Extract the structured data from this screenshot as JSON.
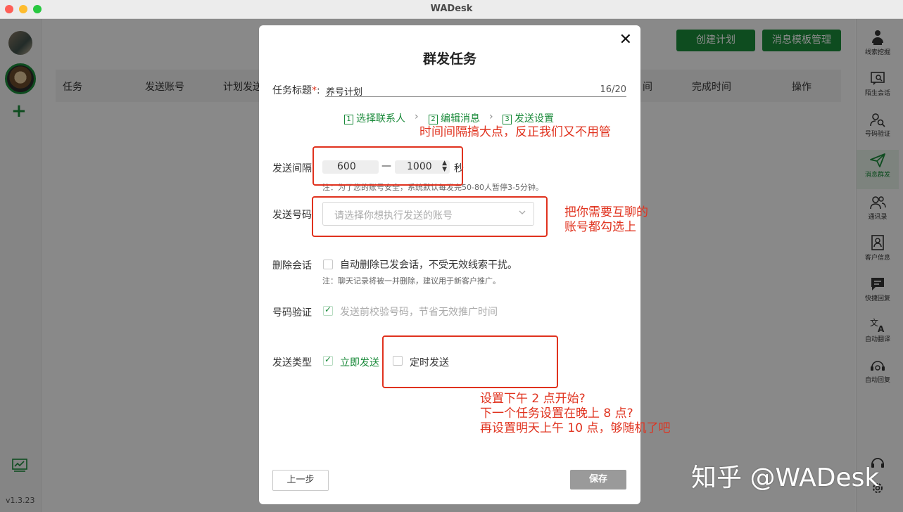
{
  "app": {
    "title": "WADesk",
    "version": "v1.3.23"
  },
  "colors": {
    "brand_green": "#1a8a3a",
    "annotation_red": "#e0321e"
  },
  "toolbar": {
    "create_plan": "创建计划",
    "template_manage": "消息模板管理"
  },
  "table": {
    "col_task": "任务",
    "col_account": "发送账号",
    "col_plan": "计划发送",
    "col_time": "间",
    "col_done": "完成时间",
    "col_action": "操作"
  },
  "right_nav": [
    {
      "label": "线索挖掘",
      "icon": "person-dig-icon"
    },
    {
      "label": "陌生会话",
      "icon": "chat-search-icon"
    },
    {
      "label": "号码验证",
      "icon": "user-search-icon"
    },
    {
      "label": "消息群发",
      "icon": "send-icon",
      "active": true
    },
    {
      "label": "通讯录",
      "icon": "contacts-icon"
    },
    {
      "label": "客户信息",
      "icon": "customer-info-icon"
    },
    {
      "label": "快捷回复",
      "icon": "quick-reply-icon"
    },
    {
      "label": "自动翻译",
      "icon": "translate-icon"
    },
    {
      "label": "自动回复",
      "icon": "auto-reply-icon"
    }
  ],
  "modal": {
    "title": "群发任务",
    "task_title_label": "任务标题",
    "task_title_required": "*",
    "task_title_colon": ":",
    "task_title_value": "养号计划",
    "task_title_count": "16/20",
    "steps": [
      {
        "num": "1",
        "label": "选择联系人"
      },
      {
        "num": "2",
        "label": "编辑消息"
      },
      {
        "num": "3",
        "label": "发送设置"
      }
    ],
    "interval_label": "发送间隔",
    "interval_min": "600",
    "interval_max": "1000",
    "interval_unit": "秒",
    "interval_note": "注：为了您的账号安全，系统默认每发完50-80人暂停3-5分钟。",
    "account_label": "发送号码",
    "account_placeholder": "请选择你想执行发送的账号",
    "delete_label": "删除会话",
    "delete_option": "自动删除已发会话，不受无效线索干扰。",
    "delete_note": "注：聊天记录将被一并删除，建议用于新客户推广。",
    "verify_label": "号码验证",
    "verify_option": "发送前校验号码，节省无效推广时间",
    "send_type_label": "发送类型",
    "send_now": "立即发送",
    "send_scheduled": "定时发送",
    "prev_button": "上一步",
    "save_button": "保存"
  },
  "annotations": {
    "interval_tip": "时间间隔搞大点，反正我们又不用管",
    "account_tip_line1": "把你需要互聊的",
    "account_tip_line2": "账号都勾选上",
    "schedule_tip_line1": "设置下午 2 点开始?",
    "schedule_tip_line2": "下一个任务设置在晚上 8 点?",
    "schedule_tip_line3": "再设置明天上午 10 点，够随机了吧"
  },
  "watermark": "知乎 @WADesk"
}
